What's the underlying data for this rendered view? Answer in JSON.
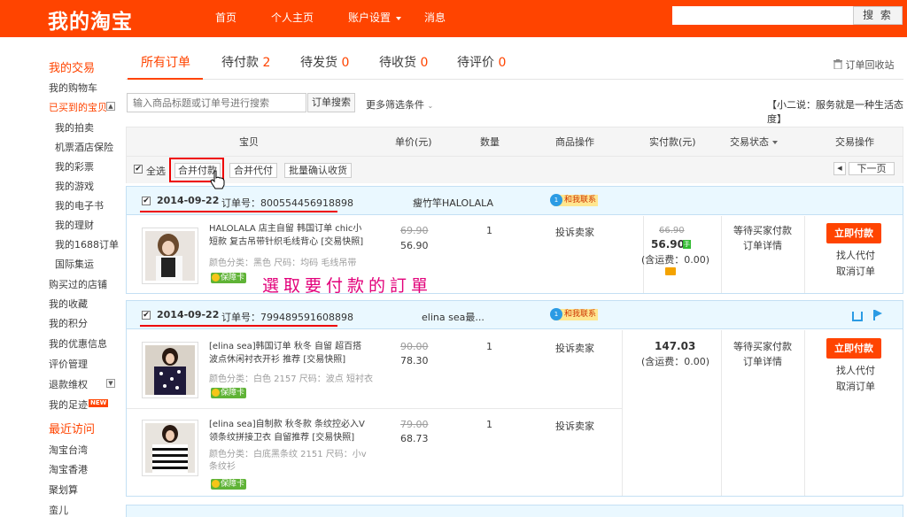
{
  "header": {
    "logo": "我的淘宝",
    "nav": [
      "首页",
      "个人主页",
      "账户设置",
      "消息"
    ],
    "search_button": "搜 索"
  },
  "sidebar": {
    "my_trades": "我的交易",
    "cart": "我的购物车",
    "bought": "已买到的宝贝",
    "sub_items": [
      "我的拍卖",
      "机票酒店保险",
      "我的彩票",
      "我的游戏",
      "我的电子书",
      "我的理财",
      "我的1688订单",
      "国际集运"
    ],
    "items2": [
      "购买过的店铺",
      "我的收藏",
      "我的积分",
      "我的优惠信息",
      "评价管理",
      "退款维权",
      "我的足迹"
    ],
    "new_badge": "NEW",
    "recent": "最近访问",
    "recent_items": [
      "淘宝台湾",
      "淘宝香港",
      "聚划算",
      "蛮儿"
    ]
  },
  "tabs": {
    "all": "所有订单",
    "unpaid": "待付款",
    "unpaid_count": "2",
    "unshipped": "待发货",
    "unshipped_count": "0",
    "unreceived": "待收货",
    "unreceived_count": "0",
    "unrated": "待评价",
    "unrated_count": "0",
    "recycle": "订单回收站"
  },
  "search": {
    "placeholder": "输入商品标题或订单号进行搜索",
    "button": "订单搜索",
    "more": "更多筛选条件",
    "slogan": "【小二说：服务就是一种生活态度】"
  },
  "table_header": {
    "item": "宝贝",
    "unit_price": "单价(元)",
    "qty": "数量",
    "item_ops": "商品操作",
    "paid": "实付款(元)",
    "status": "交易状态",
    "actions": "交易操作"
  },
  "toolbar": {
    "select_all": "全选",
    "merge_pay": "合并付款",
    "merge_proxy": "合并代付",
    "batch_confirm": "批量确认收货",
    "next_page": "下一页"
  },
  "orders": [
    {
      "date": "2014-09-22",
      "order_no_label": "订单号：",
      "order_no": "800554456918898",
      "seller": "瘦竹竿HALOLALA",
      "contact": "和我联系",
      "items": [
        {
          "title": "HALOLALA 店主自留 韩国订单 chic小短款 复古吊带针织毛线背心 [交易快照]",
          "attr": "颜色分类：黑色  尺码：均码 毛线吊带",
          "guarantee": "保障卡",
          "orig_price": "69.90",
          "price": "56.90",
          "qty": "1",
          "op": "投诉卖家"
        }
      ],
      "paid_orig": "66.90",
      "paid": "56.90",
      "shipping": "(含运费：0.00)",
      "status": [
        "等待买家付款",
        "订单详情"
      ],
      "pay_button": "立即付款",
      "actions": [
        "找人代付",
        "取消订单"
      ]
    },
    {
      "date": "2014-09-22",
      "order_no_label": "订单号：",
      "order_no": "799489591608898",
      "seller": "elina sea最...",
      "contact": "和我联系",
      "items": [
        {
          "title": "[elina sea]韩国订单 秋冬 自留 超百搭波点休闲衬衣开衫 推荐 [交易快照]",
          "attr": "颜色分类：白色 2157 尺码：波点 短衬衣",
          "guarantee": "保障卡",
          "orig_price": "90.00",
          "price": "78.30",
          "qty": "1",
          "op": "投诉卖家"
        },
        {
          "title": "[elina sea]自制款 秋冬款 条纹控必入V领条纹拼接卫衣 自留推荐 [交易快照]",
          "attr": "颜色分类：白底黑条纹 2151 尺码：小v条纹衫",
          "guarantee": "保障卡",
          "orig_price": "79.00",
          "price": "68.73",
          "qty": "1",
          "op": "投诉卖家"
        }
      ],
      "paid": "147.03",
      "shipping": "(含运费：0.00)",
      "status": [
        "等待买家付款",
        "订单详情"
      ],
      "pay_button": "立即付款",
      "actions": [
        "找人代付",
        "取消订单"
      ]
    }
  ],
  "annotation": "選取要付款的訂單",
  "colors": {
    "brand": "#ff4400",
    "highlight": "#e00000",
    "annotation": "#e2007a",
    "order_header": "#eaf8ff"
  }
}
